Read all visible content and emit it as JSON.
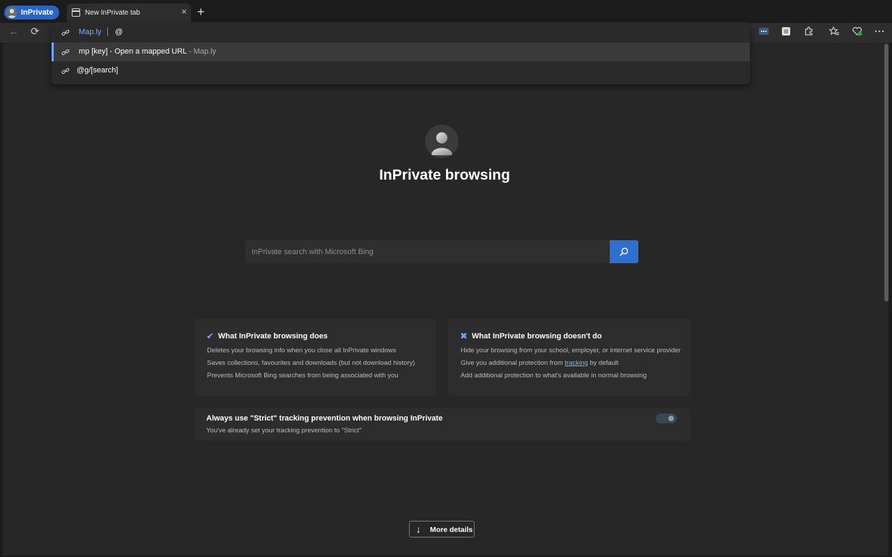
{
  "tabstrip": {
    "inprivate_label": "InPrivate",
    "tab_title": "New InPrivate tab",
    "tab_close": "×",
    "new_tab": "+"
  },
  "toolbar": {
    "back": "←",
    "reload": "⟳"
  },
  "omnibox": {
    "keyword": "Map.ly",
    "typed": "@",
    "suggestions": [
      {
        "text": "mp [key] - Open a mapped URL",
        "sub": " - Map.ly"
      },
      {
        "text": "@g/[search]",
        "sub": ""
      }
    ]
  },
  "page": {
    "title": "InPrivate browsing",
    "search_placeholder": "InPrivate search with Microsoft Bing",
    "does": {
      "title": "What InPrivate browsing does",
      "lines": [
        "Deletes your browsing info when you close all InPrivate windows",
        "Saves collections, favourites and downloads (but not download history)",
        "Prevents Microsoft Bing searches from being associated with you"
      ]
    },
    "doesnt": {
      "title": "What InPrivate browsing doesn't do",
      "line1": "Hide your browsing from your school, employer, or internet service provider",
      "line2_pre": "Give you additional protection from ",
      "line2_link": "tracking",
      "line2_post": " by default",
      "line3": "Add additional protection to what's available in normal browsing"
    },
    "strict": {
      "title": "Always use \"Strict\" tracking prevention when browsing InPrivate",
      "subtitle": "You've already set your tracking prevention to \"Strict\"",
      "enabled": true
    },
    "more_details": "More details"
  },
  "colors": {
    "accent": "#2f6fd1",
    "link": "#7fb0ff",
    "background": "#272727"
  }
}
